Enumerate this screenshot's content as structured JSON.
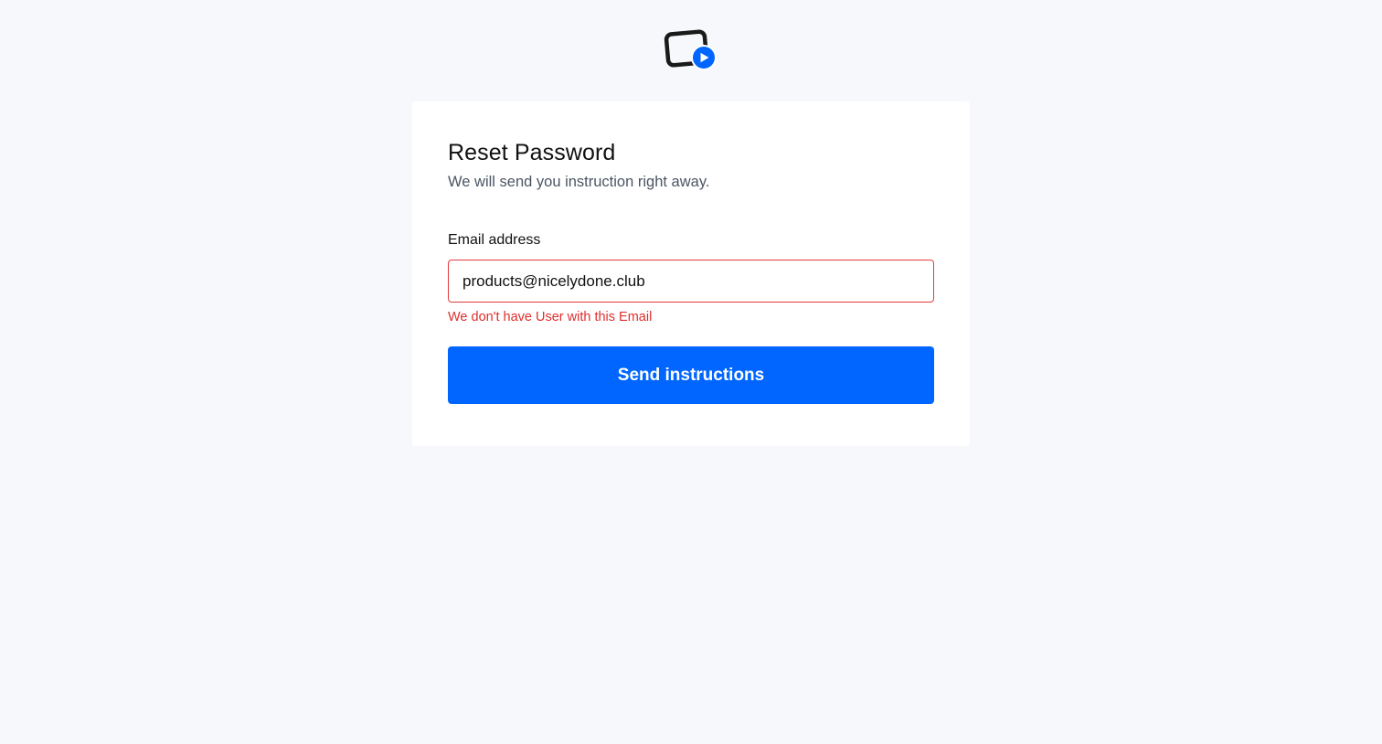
{
  "logo": {
    "icon": "video-card-play-icon",
    "frame_color": "#1a1a1a",
    "badge_color": "#0066ff"
  },
  "form": {
    "title": "Reset Password",
    "subtitle": "We will send you instruction right away.",
    "email_label": "Email address",
    "email_value": "products@nicelydone.club",
    "error_message": "We don't have User with this Email",
    "submit_label": "Send instructions"
  },
  "colors": {
    "background": "#f7f8fb",
    "accent": "#0066ff",
    "error": "#e02d2d"
  }
}
